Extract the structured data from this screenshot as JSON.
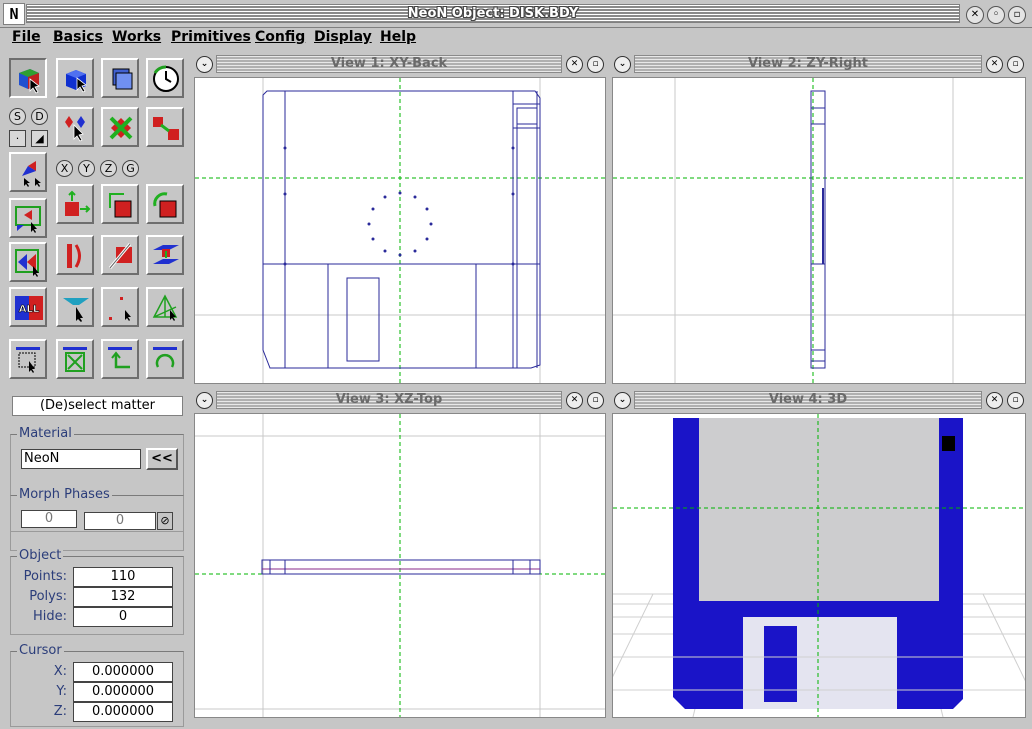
{
  "window": {
    "title": "NeoN Object: DISK.BDY",
    "logo": "N",
    "buttons": [
      "close",
      "minimize",
      "maximize"
    ]
  },
  "menu": [
    "File",
    "Basics",
    "Works",
    "Primitives",
    "Config",
    "Display",
    "Help"
  ],
  "toolbar": {
    "toggle_labels": [
      "S",
      "D"
    ],
    "axis_labels": [
      "X",
      "Y",
      "Z",
      "G"
    ],
    "all_label": "ALL",
    "status": "(De)select matter"
  },
  "material": {
    "label": "Material",
    "value": "NeoN",
    "button": "<<"
  },
  "morph": {
    "label": "Morph Phases",
    "value1": "0",
    "value2": "0"
  },
  "object": {
    "label": "Object",
    "points_label": "Points:",
    "points": "110",
    "polys_label": "Polys:",
    "polys": "132",
    "hide_label": "Hide:",
    "hide": "0"
  },
  "cursor": {
    "label": "Cursor",
    "x_label": "X:",
    "x": "0.000000",
    "y_label": "Y:",
    "y": "0.000000",
    "z_label": "Z:",
    "z": "0.000000"
  },
  "views": [
    {
      "title": "View 1: XY-Back"
    },
    {
      "title": "View 2: ZY-Right"
    },
    {
      "title": "View 3: XZ-Top"
    },
    {
      "title": "View 4: 3D"
    }
  ],
  "colors": {
    "wire": "#2a2a9a",
    "disk_blue": "#1a14c8",
    "label_gray": "#cdcdcf",
    "shutter": "#e4e4f0",
    "grid": "#c8c8c8",
    "axis": "#00b400"
  }
}
